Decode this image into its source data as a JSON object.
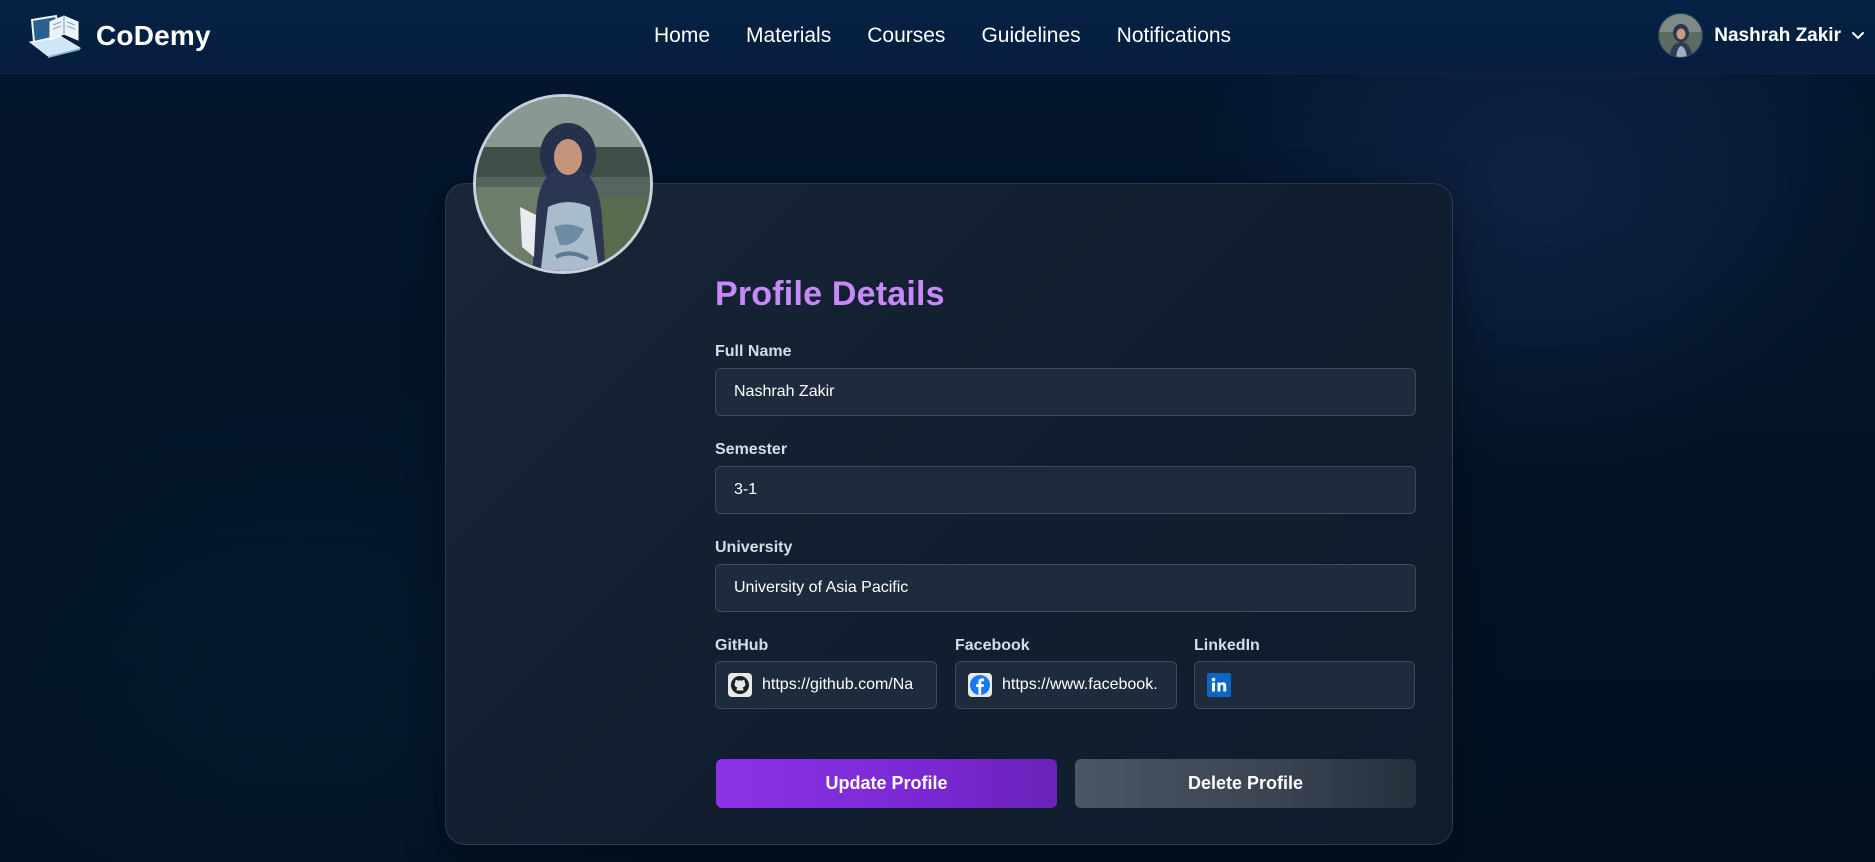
{
  "brand": {
    "name": "CoDemy",
    "logo_icon": "laptop-book-icon"
  },
  "nav": {
    "links": [
      "Home",
      "Materials",
      "Courses",
      "Guidelines",
      "Notifications"
    ]
  },
  "user": {
    "name": "Nashrah Zakir",
    "caret_icon": "chevron-down-icon"
  },
  "profile": {
    "title": "Profile Details",
    "full_name": {
      "label": "Full Name",
      "value": "Nashrah Zakir"
    },
    "semester": {
      "label": "Semester",
      "value": "3-1"
    },
    "university": {
      "label": "University",
      "value": "University of Asia Pacific"
    },
    "github": {
      "label": "GitHub",
      "value": "https://github.com/Na",
      "icon": "github-icon"
    },
    "facebook": {
      "label": "Facebook",
      "value": "https://www.facebook.",
      "icon": "facebook-icon"
    },
    "linkedin": {
      "label": "LinkedIn",
      "value": "",
      "icon": "linkedin-icon"
    },
    "update_label": "Update Profile",
    "delete_label": "Delete Profile"
  },
  "colors": {
    "accent_title": "#c58af7",
    "update_button": "#8b33e6",
    "delete_button": "#4b5563",
    "navbar": "#062246"
  }
}
